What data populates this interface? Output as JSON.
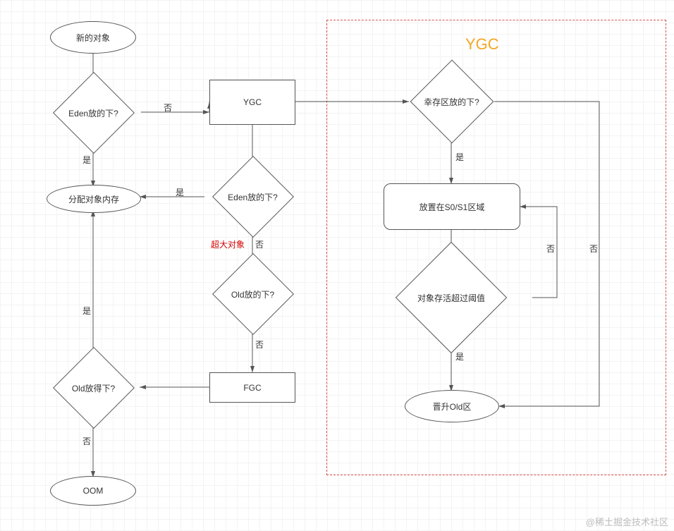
{
  "title": "YGC",
  "nodes": {
    "newObj": "新的对象",
    "edenFits1": "Eden放的下?",
    "allocMem": "分配对象内存",
    "ygc": "YGC",
    "edenFits2": "Eden放的下?",
    "oldFits1": "Old放的下?",
    "fgc": "FGC",
    "oldFits2": "Old放得下?",
    "oom": "OOM",
    "survivorFits": "幸存区放的下?",
    "placeS0S1": "放置在S0/S1区域",
    "ageExceeds": "对象存活超过阈值",
    "promoteOld": "晋升Old区"
  },
  "labels": {
    "yes": "是",
    "no": "否",
    "huge": "超大对象"
  },
  "watermark": "@稀土掘金技术社区"
}
